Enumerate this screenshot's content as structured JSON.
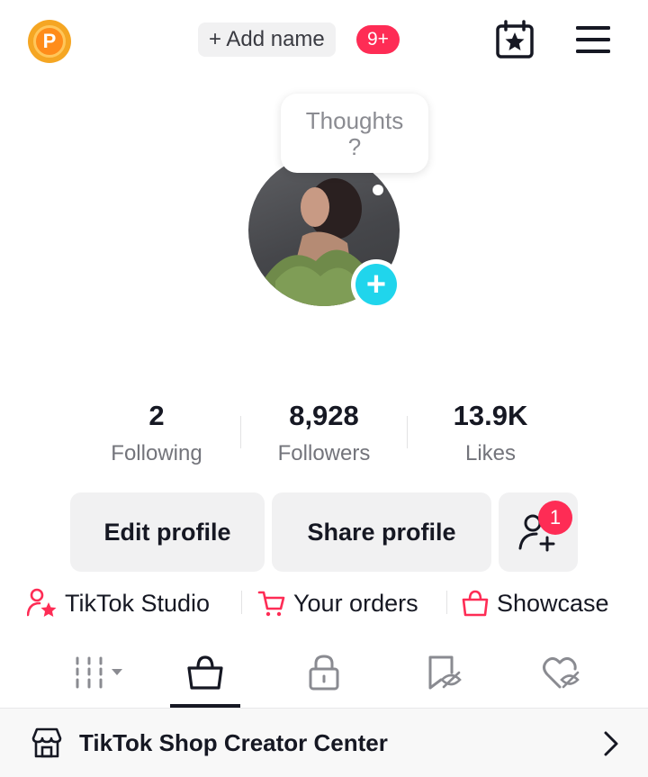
{
  "header": {
    "coin_letter": "P",
    "add_name_label": "+ Add name",
    "notification_badge": "9+"
  },
  "profile": {
    "thoughts_prompt_line1": "Thoughts",
    "thoughts_prompt_line2": "?"
  },
  "stats": [
    {
      "value": "2",
      "label": "Following"
    },
    {
      "value": "8,928",
      "label": "Followers"
    },
    {
      "value": "13.9K",
      "label": "Likes"
    }
  ],
  "actions": {
    "edit_profile": "Edit profile",
    "share_profile": "Share profile",
    "add_friend_badge": "1"
  },
  "links": [
    {
      "label": "TikTok Studio",
      "icon": "person-star-icon"
    },
    {
      "label": "Your orders",
      "icon": "cart-icon"
    },
    {
      "label": "Showcase",
      "icon": "shopping-bag-icon"
    }
  ],
  "tabs": [
    {
      "icon": "grid-icon",
      "active": false
    },
    {
      "icon": "shopping-bag-icon",
      "active": true
    },
    {
      "icon": "lock-icon",
      "active": false
    },
    {
      "icon": "bookmark-hidden-icon",
      "active": false
    },
    {
      "icon": "heart-hidden-icon",
      "active": false
    }
  ],
  "shop_banner": {
    "title": "TikTok Shop Creator Center"
  },
  "colors": {
    "accent_red": "#fe2c55",
    "accent_cyan": "#20d5ec",
    "coin_orange": "#f5a623",
    "text_primary": "#161823",
    "text_secondary": "#73747b"
  }
}
